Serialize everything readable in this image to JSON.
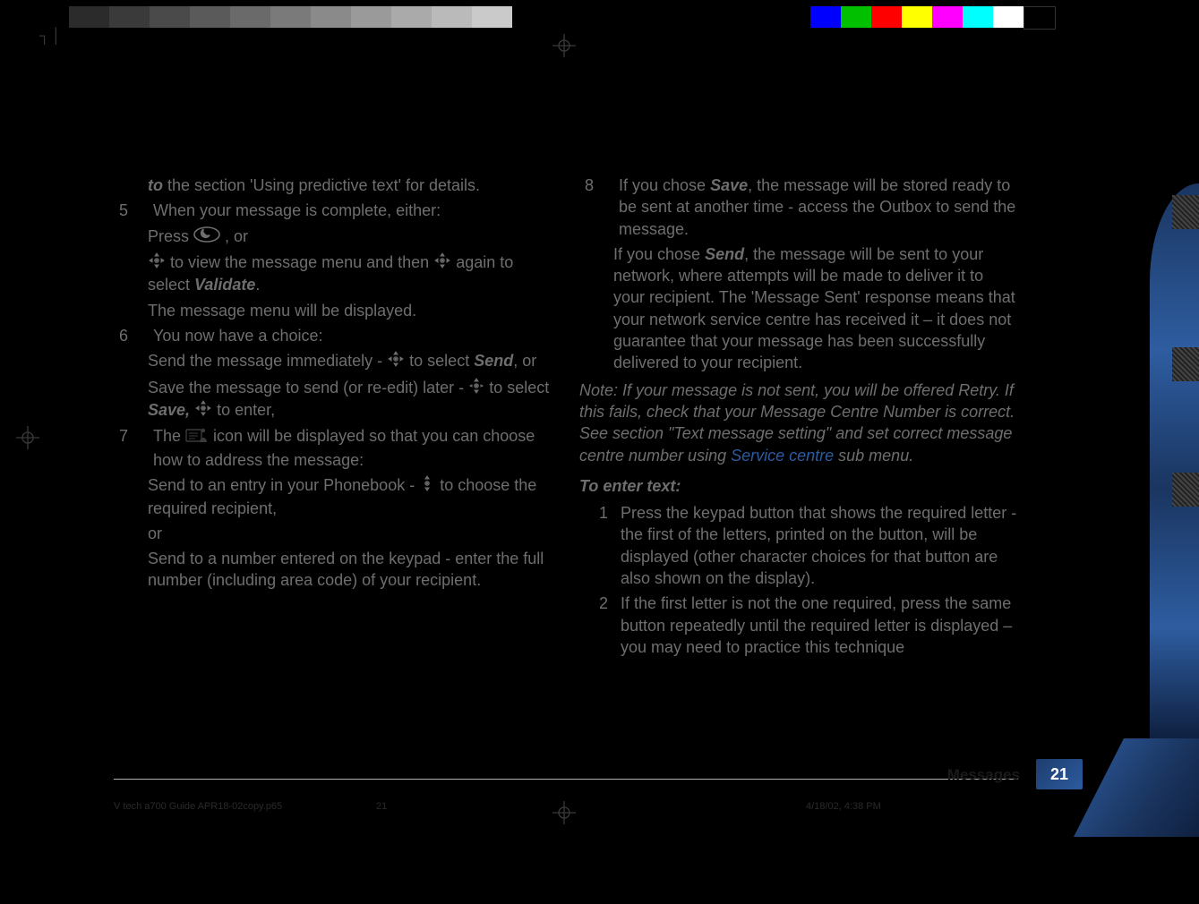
{
  "top_greys": [
    "#2b2b2b",
    "#3a3a3a",
    "#4a4a4a",
    "#5a5a5a",
    "#6a6a6a",
    "#7a7a7a",
    "#8a8a8a",
    "#9a9a9a",
    "#aaaaaa",
    "#bababa",
    "#cacaca"
  ],
  "top_colors": [
    "#0000ff",
    "#00c000",
    "#ff0000",
    "#ffff00",
    "#ff00ff",
    "#00ffff",
    "#ffffff",
    "#000000"
  ],
  "left": {
    "l4_pre": "to",
    "l4_post": "  the section 'Using predictive text' for details.",
    "l5_num": "5",
    "l5_txt": "When your message is complete, either:",
    "l5a_pre": "Press ",
    "l5a_post": ", or",
    "l5b_pre": "",
    "l5b_mid": " to view the message menu and then ",
    "l5b_post": " again to select ",
    "l5b_em": "Validate",
    "l5b_dot": ".",
    "l5_after": "The message menu will be displayed.",
    "l6_num": "6",
    "l6_txt": "You now  have a choice:",
    "l6a_pre": "Send the message immediately - ",
    "l6a_post": " to select ",
    "l6a_em": "Send",
    "l6a_tail": ", or",
    "l6b_pre": "Save the message to send (or re-edit) later - ",
    "l6b_mid": " to select ",
    "l6b_em": "Save, ",
    "l6b_post": " to enter,",
    "l7_num": "7",
    "l7_pre": "The ",
    "l7_post": " icon will be displayed so that you can choose how to address the message:",
    "l7a_pre": "Send to an entry in your Phonebook - ",
    "l7a_post": " to choose the required recipient,",
    "l7_or": "or",
    "l7b": "Send to a number entered on the keypad - enter the full number (including area code) of your recipient."
  },
  "right": {
    "l8_num": "8",
    "l8_pre": "If you chose ",
    "l8_save": "Save",
    "l8_post": ", the message will be stored ready to be sent at another time - access the Outbox to send the message.",
    "l8b_pre": "If you chose ",
    "l8b_send": "Send",
    "l8b_post": ", the message will be sent to your network, where attempts will be made to deliver it to your recipient. The 'Message Sent' response means that your network service centre has received it –  it does not guarantee that your message has been successfully delivered to your recipient.",
    "note_pre": "Note: If your message is not sent, you will be offered Retry. If this fails, check that your Message Centre Number is correct. See section \"Text message setting\" and set correct message centre number using ",
    "note_link": "Service centre",
    "note_post": " sub menu.",
    "enter_head": "To enter text:",
    "e1_num": "1",
    "e1_txt": "Press the keypad button that shows the required letter - the first of the letters, printed on the button, will be displayed (other character choices for that button are also shown on the display).",
    "e2_num": "2",
    "e2_txt": "If the first letter is not the one required, press the same button repeatedly until the required letter is displayed – you may need to practice this technique"
  },
  "footer": {
    "section": "Messages",
    "page": "21",
    "file": "V tech a700 Guide APR18-02copy.p65",
    "sheet": "21",
    "timestamp": "4/18/02, 4:38 PM"
  }
}
